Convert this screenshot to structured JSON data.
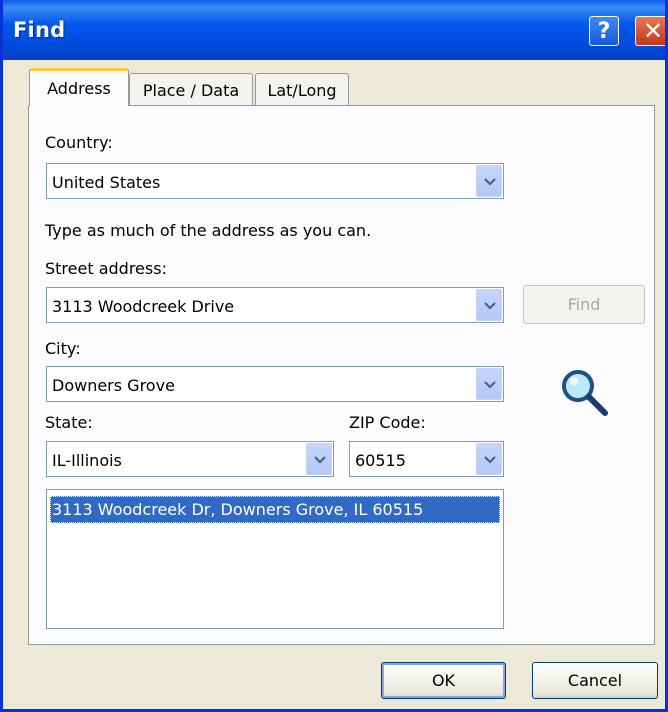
{
  "window": {
    "title": "Find"
  },
  "tabs": [
    {
      "label": "Address",
      "active": true
    },
    {
      "label": "Place / Data",
      "active": false
    },
    {
      "label": "Lat/Long",
      "active": false
    }
  ],
  "address": {
    "country_label": "Country:",
    "country_value": "United States",
    "hint": "Type as much of the address as you can.",
    "street_label": "Street address:",
    "street_value": "3113 Woodcreek Drive",
    "find_button": "Find",
    "city_label": "City:",
    "city_value": "Downers Grove",
    "state_label": "State:",
    "state_value": "IL-Illinois",
    "zip_label": "ZIP Code:",
    "zip_value": "60515",
    "results": [
      "3113 Woodcreek Dr, Downers Grove, IL 60515"
    ]
  },
  "buttons": {
    "ok": "OK",
    "cancel": "Cancel"
  },
  "icons": {
    "search": "magnifier-icon",
    "dropdown": "chevron-down-icon"
  },
  "colors": {
    "titlebar": "#0058ee",
    "selection": "#316ac5",
    "active_tab_accent": "#ffc83c"
  }
}
